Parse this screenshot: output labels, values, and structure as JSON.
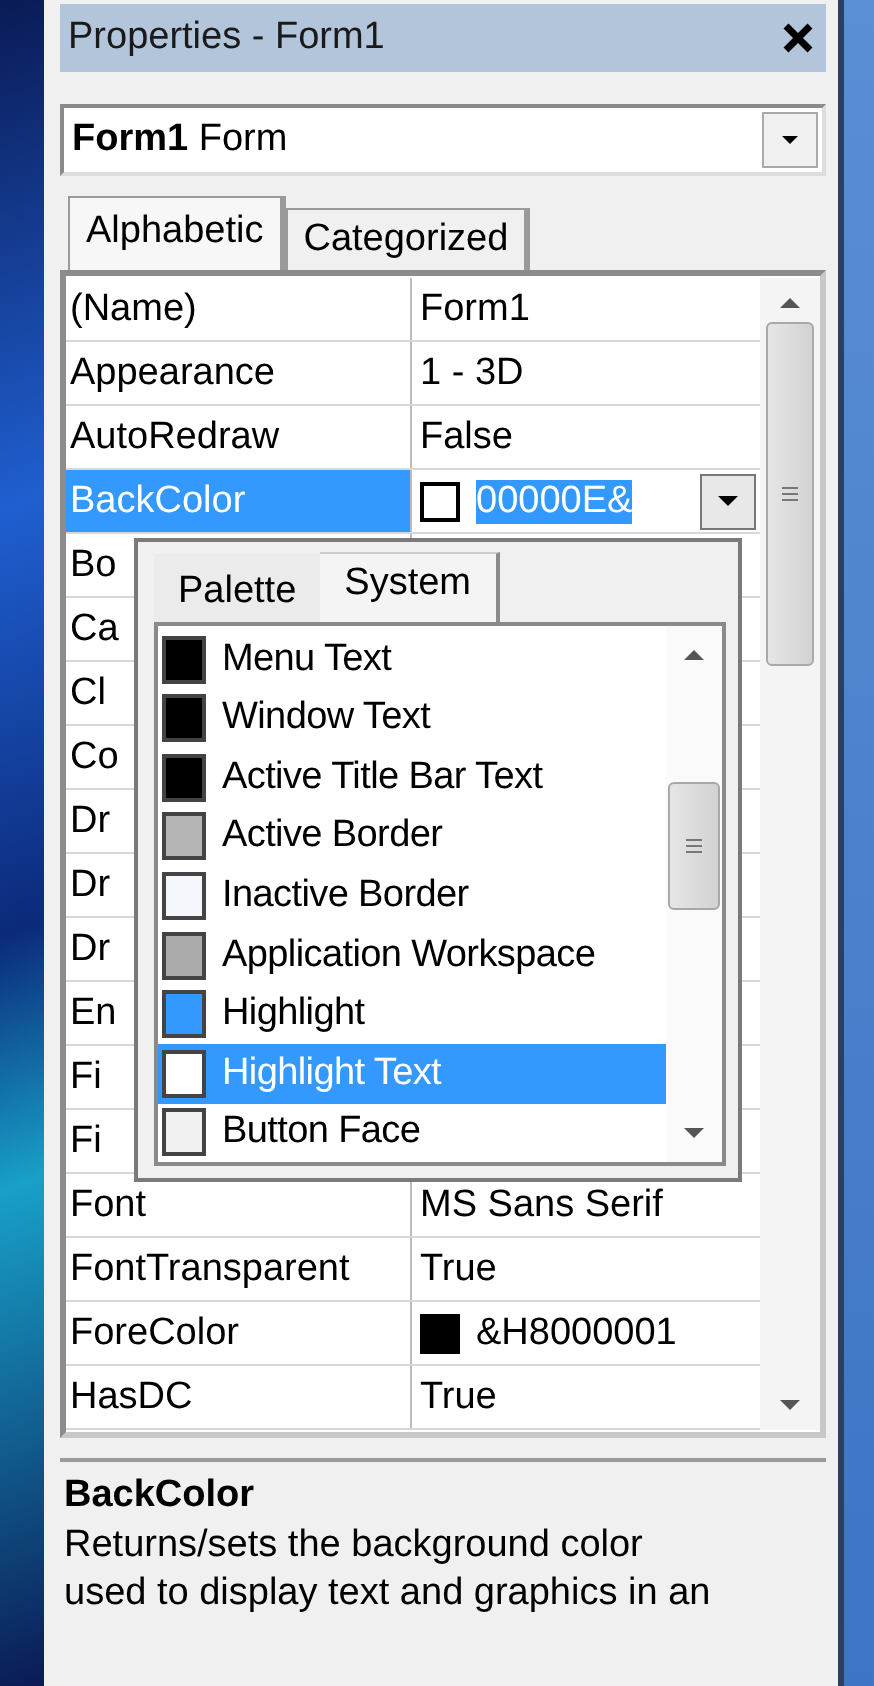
{
  "window": {
    "title": "Properties - Form1"
  },
  "object_selector": {
    "name": "Form1",
    "type": "Form"
  },
  "tabs": [
    {
      "label": "Alphabetic",
      "selected": true
    },
    {
      "label": "Categorized",
      "selected": false
    }
  ],
  "properties": [
    {
      "kind": "text",
      "name": "(Name)",
      "value": "Form1",
      "selected": false
    },
    {
      "kind": "text",
      "name": "Appearance",
      "value": "1 - 3D",
      "selected": false
    },
    {
      "kind": "text",
      "name": "AutoRedraw",
      "value": "False",
      "selected": false
    },
    {
      "kind": "color",
      "name": "BackColor",
      "value": "00000E&",
      "color": "#ffffff",
      "selected": true
    },
    {
      "name": "Bo",
      "selected": false
    },
    {
      "name": "Ca",
      "selected": false
    },
    {
      "name": "Cl",
      "selected": false
    },
    {
      "name": "Co",
      "selected": false
    },
    {
      "name": "Dr",
      "selected": false
    },
    {
      "name": "Dr",
      "selected": false
    },
    {
      "name": "Dr",
      "selected": false
    },
    {
      "name": "En",
      "selected": false
    },
    {
      "name": "Fi",
      "selected": false
    },
    {
      "name": "Fi",
      "selected": false
    },
    {
      "kind": "text",
      "name": "Font",
      "value": "MS Sans Serif",
      "selected": false
    },
    {
      "kind": "text",
      "name": "FontTransparent",
      "value": "True",
      "selected": false
    },
    {
      "kind": "color",
      "name": "ForeColor",
      "value": "&H8000001",
      "color": "#000000",
      "selected": false
    },
    {
      "kind": "text",
      "name": "HasDC",
      "value": "True",
      "selected": false
    }
  ],
  "color_picker": {
    "tabs": [
      {
        "label": "Palette",
        "selected": false
      },
      {
        "label": "System",
        "selected": true
      }
    ],
    "items": [
      {
        "label": "Menu Text",
        "color": "#000000",
        "selected": false
      },
      {
        "label": "Window Text",
        "color": "#000000",
        "selected": false
      },
      {
        "label": "Active Title Bar Text",
        "color": "#000000",
        "selected": false
      },
      {
        "label": "Active Border",
        "color": "#b4b4b4",
        "selected": false
      },
      {
        "label": "Inactive Border",
        "color": "#f4f7fc",
        "selected": false
      },
      {
        "label": "Application Workspace",
        "color": "#ababab",
        "selected": false
      },
      {
        "label": "Highlight",
        "color": "#3399ff",
        "selected": false
      },
      {
        "label": "Highlight Text",
        "color": "#ffffff",
        "selected": true
      },
      {
        "label": "Button Face",
        "color": "#f0f0f0",
        "selected": false
      }
    ]
  },
  "description": {
    "title": "BackColor",
    "text": "Returns/sets the background color used to display text and graphics in an"
  }
}
